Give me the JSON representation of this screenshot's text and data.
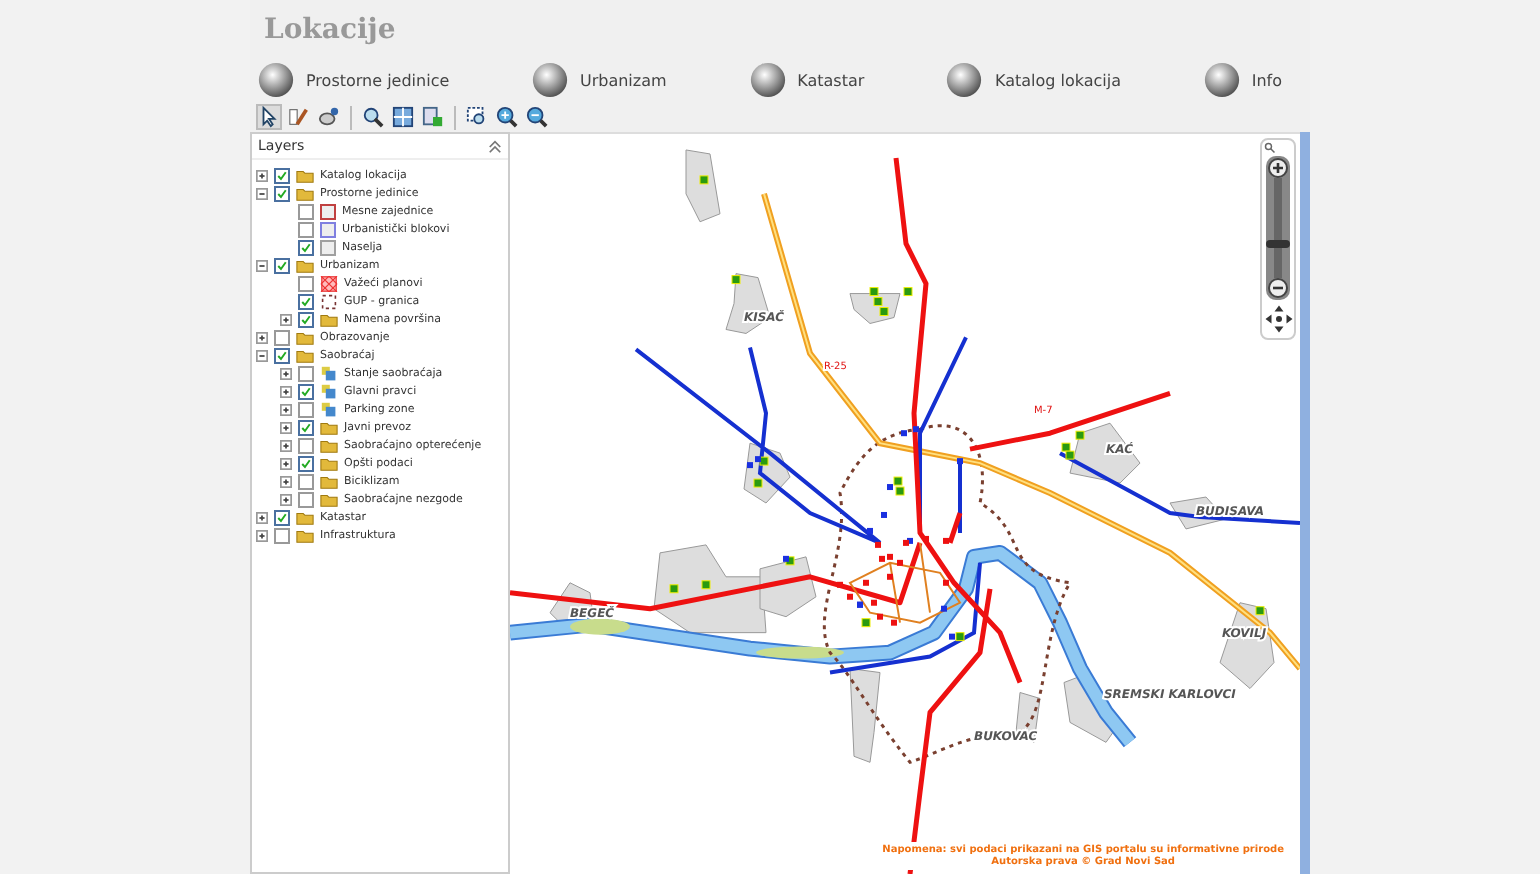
{
  "title": "Lokacije",
  "menu": [
    {
      "label": "Prostorne jedinice"
    },
    {
      "label": "Urbanizam"
    },
    {
      "label": "Katastar"
    },
    {
      "label": "Katalog lokacija"
    },
    {
      "label": "Info"
    }
  ],
  "toolbar": [
    [
      {
        "kind": "select",
        "selected": true
      },
      {
        "kind": "edit",
        "selected": false
      },
      {
        "kind": "info",
        "selected": false
      }
    ],
    [
      {
        "kind": "find",
        "selected": false
      },
      {
        "kind": "extent",
        "selected": false
      },
      {
        "kind": "export",
        "selected": false
      }
    ],
    [
      {
        "kind": "zoombox",
        "selected": false
      },
      {
        "kind": "zoomin",
        "selected": false
      },
      {
        "kind": "zoomout",
        "selected": false
      }
    ]
  ],
  "layers": {
    "title": "Layers",
    "items": [
      {
        "label": "Katalog lokacija",
        "kind": "folder",
        "checked": true,
        "expanded": false
      },
      {
        "label": "Prostorne jedinice",
        "kind": "folder",
        "checked": true,
        "expanded": true,
        "children": [
          {
            "label": "Mesne zajednice",
            "kind": "swatch",
            "color": "#c04040",
            "checked": false
          },
          {
            "label": "Urbanistički blokovi",
            "kind": "swatch",
            "color": "#8080e0",
            "checked": false
          },
          {
            "label": "Naselja",
            "kind": "swatch",
            "color": "#a0a0a0",
            "checked": true
          }
        ]
      },
      {
        "label": "Urbanizam",
        "kind": "folder",
        "checked": true,
        "expanded": true,
        "children": [
          {
            "label": "Važeći planovi",
            "kind": "pattern",
            "checked": false
          },
          {
            "label": "GUP - granica",
            "kind": "dashed",
            "checked": true
          },
          {
            "label": "Namena površina",
            "kind": "folder",
            "checked": true,
            "expanded": false
          }
        ]
      },
      {
        "label": "Obrazovanje",
        "kind": "folder",
        "checked": false,
        "expanded": false
      },
      {
        "label": "Saobraćaj",
        "kind": "folder",
        "checked": true,
        "expanded": true,
        "children": [
          {
            "label": "Stanje saobraćaja",
            "kind": "layers",
            "checked": false,
            "expanded": false
          },
          {
            "label": "Glavni pravci",
            "kind": "layers",
            "checked": true,
            "expanded": false
          },
          {
            "label": "Parking zone",
            "kind": "layers",
            "checked": false,
            "expanded": false
          },
          {
            "label": "Javni prevoz",
            "kind": "folder",
            "checked": true,
            "expanded": false
          },
          {
            "label": "Saobraćajno opterećenje",
            "kind": "folder",
            "checked": false,
            "expanded": false
          },
          {
            "label": "Opšti podaci",
            "kind": "folder",
            "checked": true,
            "expanded": false
          },
          {
            "label": "Biciklizam",
            "kind": "folder",
            "checked": false,
            "expanded": false
          },
          {
            "label": "Saobraćajne nezgode",
            "kind": "folder",
            "checked": false,
            "expanded": false
          }
        ]
      },
      {
        "label": "Katastar",
        "kind": "folder",
        "checked": true,
        "expanded": false
      },
      {
        "label": "Infrastruktura",
        "kind": "folder",
        "checked": false,
        "expanded": false
      }
    ]
  },
  "map": {
    "labels": [
      {
        "text": "KISAČ",
        "kind": "town"
      },
      {
        "text": "R-25",
        "kind": "road"
      },
      {
        "text": "M-7",
        "kind": "road"
      },
      {
        "text": "KAĆ",
        "kind": "town"
      },
      {
        "text": "BUDISAVA",
        "kind": "town"
      },
      {
        "text": "KOVILJ",
        "kind": "town"
      },
      {
        "text": "BEGEČ",
        "kind": "town"
      },
      {
        "text": "SREMSKI KARLOVCI",
        "kind": "town"
      },
      {
        "text": "BUKOVAC",
        "kind": "town"
      }
    ],
    "zoom": {
      "level": 0.3
    },
    "notes": [
      "Napomena: svi podaci prikazani na GIS portalu su informativne prirode",
      "Autorska prava © Grad Novi Sad"
    ]
  }
}
